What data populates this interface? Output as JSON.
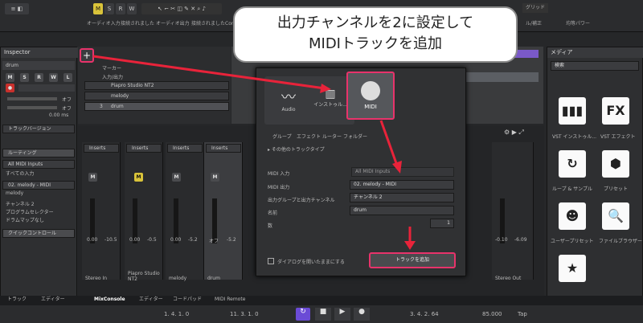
{
  "toolbar": {
    "buttons": [
      "M",
      "S",
      "R",
      "W"
    ],
    "row2": [
      "オーディオ入力",
      "接続されました",
      "オーディオ出力",
      "接続されました",
      "Con"
    ],
    "right_items": [
      "グリッド",
      "1/4",
      "サウンドな比較",
      "ル/補正",
      "均等パワー"
    ]
  },
  "callout": {
    "line1": "出力チャンネルを2に設定して",
    "line2": "MIDIトラックを追加"
  },
  "inspector": {
    "title": "Inspector",
    "track_name": "drum",
    "buttons": [
      "M",
      "S",
      "R",
      "W",
      "L"
    ],
    "off1": "オフ",
    "off2": "オフ",
    "time": "0.00 ms",
    "version_label": "トラックバージョン",
    "routing_label": "ルーティング",
    "midi_in": "All MIDI Inputs",
    "all_in": "すべての入力",
    "out_port": "02. melody - MIDI",
    "out_dev": "melody",
    "channel": "チャンネル 2",
    "program": "プログラムセレクター",
    "drummap": "ドラムマップなし",
    "quick_label": "クイックコントロール"
  },
  "tracks": {
    "add_symbol": "+",
    "marker": "マーカー",
    "in_out": "入力/出力",
    "rows": [
      {
        "num": "",
        "name": "Piapro Studio NT2"
      },
      {
        "num": "",
        "name": "melody"
      },
      {
        "num": "3",
        "name": "drum"
      }
    ]
  },
  "dialog": {
    "types": [
      "Audio",
      "インストゥル...",
      "MIDI"
    ],
    "types2": [
      "グループ",
      "エフェクト",
      "ルーター",
      "フォルダー"
    ],
    "more": "その他のトラックタイプ",
    "fields": {
      "midi_in_label": "MIDI 入力",
      "midi_in_value": "All MIDI Inputs",
      "midi_out_label": "MIDI 出力",
      "midi_out_value": "02. melody - MIDI",
      "group_label": "出力グループと出力チャンネル",
      "group_value": "チャンネル 2",
      "name_label": "名前",
      "name_value": "drum",
      "count_label": "数",
      "count_value": "1"
    },
    "keep_open": "ダイアログを開いたままにする",
    "add_button": "トラックを追加"
  },
  "mixer": {
    "channels": [
      {
        "name": "Stereo In",
        "insert": "Inserts",
        "vol": "0.00",
        "pan": "-10.5"
      },
      {
        "name": "Piapro Studio NT2",
        "insert": "Inserts",
        "vol": "0.00",
        "pan": "-0.5"
      },
      {
        "name": "melody",
        "insert": "Inserts",
        "vol": "0.00",
        "pan": "-5.2"
      },
      {
        "name": "drum",
        "insert": "Inserts",
        "vol": "オフ",
        "pan": "-5.2"
      }
    ],
    "out": {
      "name": "Stereo Out",
      "vol": "-0.10",
      "pan": "-6.09"
    }
  },
  "media": {
    "title": "メディア",
    "search_placeholder": "検索",
    "tiles": [
      {
        "glyph": "▮▮▮",
        "label": "VST インストゥル..."
      },
      {
        "glyph": "FX",
        "label": "VST エフェクト"
      },
      {
        "glyph": "↻",
        "label": "ループ & サンプル"
      },
      {
        "glyph": "⬢",
        "label": "プリセット"
      },
      {
        "glyph": "☻",
        "label": "ユーザープリセット"
      },
      {
        "glyph": "🔍",
        "label": "ファイルブラウザー"
      },
      {
        "glyph": "★",
        "label": ""
      }
    ]
  },
  "bottom_tabs": [
    "トラック",
    "エディター",
    "MixConsole",
    "エディター",
    "コードパッド",
    "MIDI Remote"
  ],
  "transport": {
    "left_pos": "1. 4. 1. 0",
    "right_pos": "11. 3. 1. 0",
    "position": "3. 4. 2. 64",
    "tempo": "85.000",
    "tap": "Tap"
  }
}
